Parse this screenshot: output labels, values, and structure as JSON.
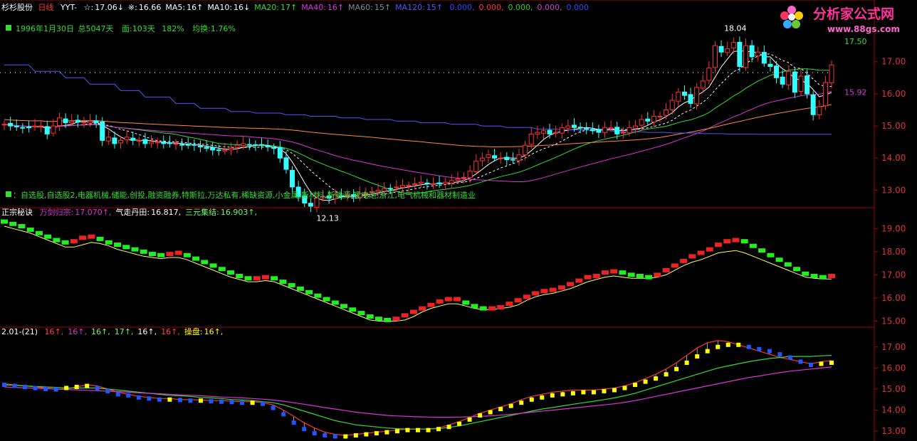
{
  "header": {
    "stock_name": "杉杉股份",
    "period": "日线",
    "indicator": "YYT-",
    "items": [
      {
        "label": "☆:",
        "value": "17.06",
        "arrow": "↓",
        "color": "#ffffff"
      },
      {
        "label": "※:",
        "value": "16.66",
        "arrow": "",
        "color": "#ffffff"
      },
      {
        "label": "MA5:",
        "value": "16",
        "arrow": "↑",
        "color": "#ffffff"
      },
      {
        "label": "MA10:",
        "value": "16",
        "arrow": "↓",
        "color": "#ffffff"
      },
      {
        "label": "MA20:",
        "value": "17",
        "arrow": "↑",
        "color": "#33dd33"
      },
      {
        "label": "MA40:",
        "value": "16",
        "arrow": "↑",
        "color": "#dd33dd"
      },
      {
        "label": "MA60:",
        "value": "15",
        "arrow": "↑",
        "color": "#888888"
      },
      {
        "label": "MA120:",
        "value": "15",
        "arrow": "↑",
        "color": "#5555ff"
      }
    ],
    "tail_values": [
      "0.000",
      "0.000",
      "0.000",
      "0.000",
      "0.000"
    ],
    "tail_colors": [
      "#3344ff",
      "#ff3333",
      "#33cc33",
      "#cc44cc",
      "#3344ff"
    ]
  },
  "info_line": {
    "date": "1996年1月30日",
    "total": "总5047天",
    "area": "面:103天",
    "pct": "182%",
    "avg_turnover": "均换:1.76%"
  },
  "sector_line": "：自选股,自选股2,电器机械,储能,创投,融资融券,特斯拉,万达私有,稀缺资源,小金属,新材料,新能源,锂电池,浙江,电气机械和器材制造业",
  "logo": {
    "title": "分析家公式网",
    "url": "www.88gs.com"
  },
  "panel2_title": {
    "name": "正宗秘诀",
    "items": [
      {
        "label": "万剑归宗:",
        "value": "17.070",
        "arrow": "↑,",
        "color": "#dd33dd"
      },
      {
        "label": "气走丹田:",
        "value": "16.817,",
        "arrow": "",
        "color": "#ffffff"
      },
      {
        "label": "三元集结:",
        "value": "16.903",
        "arrow": "↑,",
        "color": "#66ff66"
      }
    ]
  },
  "panel3_title": {
    "name": "2.01-(21)",
    "items": [
      {
        "value": "16",
        "arrow": "↑,",
        "color": "#ff4444"
      },
      {
        "value": "16",
        "arrow": "↑,",
        "color": "#dd33dd"
      },
      {
        "value": "16",
        "arrow": "↑,",
        "color": "#66ff66"
      },
      {
        "value": "17",
        "arrow": "↑,",
        "color": "#66ff66"
      },
      {
        "value": "16",
        "arrow": "↑,",
        "color": "#ffffff"
      },
      {
        "value": "16",
        "arrow": "↑,",
        "color": "#ff4444"
      },
      {
        "label": "操盘:",
        "value": "16",
        "arrow": "↑,",
        "color": "#ffff00"
      }
    ]
  },
  "chart_data": [
    {
      "type": "candlestick",
      "title": "杉杉股份 日线",
      "ylim": [
        12.5,
        18.3
      ],
      "yticks": [
        13.0,
        14.0,
        15.0,
        16.0,
        17.0
      ],
      "annotations": [
        {
          "text": "18.04",
          "kind": "high"
        },
        {
          "text": "12.13",
          "kind": "low"
        },
        {
          "text": "17.50",
          "kind": "level"
        },
        {
          "text": "15.92",
          "kind": "level"
        }
      ],
      "closes": [
        15.05,
        15.0,
        14.98,
        14.95,
        14.95,
        15.0,
        15.0,
        14.75,
        15.0,
        15.25,
        15.1,
        15.15,
        15.12,
        15.12,
        15.15,
        15.1,
        14.55,
        14.65,
        14.45,
        14.55,
        14.65,
        14.55,
        14.55,
        14.45,
        14.5,
        14.5,
        14.45,
        14.45,
        14.45,
        14.4,
        14.4,
        14.4,
        14.35,
        14.3,
        14.25,
        14.25,
        14.25,
        14.3,
        14.4,
        14.45,
        14.4,
        14.4,
        14.4,
        14.35,
        14.3,
        14.0,
        13.65,
        13.1,
        12.8,
        12.6,
        12.5,
        12.75,
        12.8,
        12.75,
        12.85,
        12.8,
        12.85,
        12.8,
        12.9,
        12.9,
        12.95,
        13.0,
        13.05,
        13.05,
        13.1,
        13.15,
        13.15,
        13.2,
        13.25,
        13.2,
        13.2,
        13.2,
        13.25,
        13.3,
        13.35,
        13.4,
        13.6,
        13.9,
        14.0,
        14.1,
        14.0,
        14.0,
        13.95,
        13.95,
        14.1,
        14.4,
        14.75,
        14.8,
        14.85,
        14.75,
        14.8,
        14.95,
        15.0,
        14.95,
        14.95,
        14.9,
        14.85,
        14.8,
        14.95,
        14.95,
        14.75,
        14.8,
        14.95,
        15.0,
        15.2,
        15.15,
        15.3,
        15.3,
        15.5,
        15.8,
        16.05,
        15.95,
        15.7,
        16.2,
        16.4,
        16.8,
        17.5,
        17.3,
        17.4,
        17.6,
        16.85,
        17.5,
        17.15,
        17.3,
        16.95,
        16.85,
        16.5,
        16.3,
        16.7,
        16.05,
        16.55,
        16.0,
        15.35,
        15.6,
        16.35,
        16.9
      ]
    },
    {
      "type": "line",
      "title": "正宗秘诀",
      "ylim": [
        14.8,
        19.5
      ],
      "yticks": [
        15.0,
        16.0,
        17.0,
        18.0,
        19.0
      ],
      "series": [
        {
          "name": "万剑归宗",
          "values": [
            19.3,
            19.2,
            19.1,
            18.95,
            18.8,
            18.65,
            18.5,
            18.4,
            18.45,
            18.6,
            18.65,
            18.55,
            18.4,
            18.3,
            18.2,
            18.1,
            18.0,
            17.9,
            17.85,
            17.9,
            17.95,
            17.85,
            17.7,
            17.55,
            17.4,
            17.25,
            17.1,
            16.95,
            16.85,
            16.85,
            16.9,
            16.85,
            16.7,
            16.55,
            16.4,
            16.25,
            16.1,
            15.95,
            15.8,
            15.65,
            15.5,
            15.35,
            15.2,
            15.1,
            15.05,
            15.1,
            15.25,
            15.4,
            15.55,
            15.7,
            15.85,
            15.95,
            15.95,
            15.8,
            15.65,
            15.55,
            15.55,
            15.6,
            15.75,
            15.9,
            16.05,
            16.2,
            16.3,
            16.35,
            16.45,
            16.6,
            16.75,
            16.9,
            16.95,
            17.1,
            17.15,
            17.1,
            17.0,
            16.95,
            16.9,
            17.0,
            17.2,
            17.4,
            17.6,
            17.8,
            17.95,
            18.1,
            18.3,
            18.45,
            18.5,
            18.45,
            18.25,
            18.05,
            17.85,
            17.65,
            17.45,
            17.25,
            17.05,
            16.95,
            16.9,
            16.95
          ]
        },
        {
          "name": "气走丹田",
          "values": [
            19.1,
            19.0,
            18.9,
            18.8,
            18.65,
            18.5,
            18.35,
            18.2,
            18.2,
            18.3,
            18.4,
            18.35,
            18.25,
            18.1,
            18.0,
            17.9,
            17.8,
            17.75,
            17.7,
            17.75,
            17.75,
            17.65,
            17.5,
            17.35,
            17.2,
            17.05,
            16.9,
            16.8,
            16.7,
            16.7,
            16.75,
            16.7,
            16.55,
            16.4,
            16.25,
            16.1,
            15.95,
            15.8,
            15.65,
            15.5,
            15.35,
            15.2,
            15.05,
            15.0,
            15.0,
            15.0,
            15.05,
            15.2,
            15.4,
            15.55,
            15.65,
            15.75,
            15.75,
            15.65,
            15.55,
            15.5,
            15.5,
            15.55,
            15.6,
            15.7,
            15.9,
            16.05,
            16.15,
            16.2,
            16.3,
            16.4,
            16.55,
            16.7,
            16.8,
            16.9,
            16.95,
            16.9,
            16.85,
            16.85,
            16.85,
            16.9,
            17.0,
            17.2,
            17.4,
            17.55,
            17.65,
            17.8,
            17.95,
            18.0,
            18.05,
            17.95,
            17.8,
            17.65,
            17.5,
            17.35,
            17.2,
            17.05,
            16.9,
            16.85,
            16.82,
            16.82
          ]
        }
      ]
    },
    {
      "type": "line",
      "title": "2.01-(21)",
      "ylim": [
        12.6,
        17.6
      ],
      "yticks": [
        13.0,
        14.0,
        15.0,
        16.0,
        17.0
      ],
      "series": [
        {
          "name": "操盘",
          "values": [
            15.2,
            15.15,
            15.1,
            15.05,
            15.0,
            14.98,
            15.05,
            15.1,
            15.15,
            15.05,
            14.9,
            14.75,
            14.7,
            14.6,
            14.55,
            14.5,
            14.5,
            14.48,
            14.45,
            14.45,
            14.42,
            14.4,
            14.38,
            14.35,
            14.35,
            14.3,
            14.1,
            13.8,
            13.4,
            13.1,
            12.9,
            12.8,
            12.75,
            12.75,
            12.8,
            12.85,
            12.9,
            12.95,
            13.0,
            13.05,
            13.05,
            13.05,
            13.1,
            13.2,
            13.35,
            13.55,
            13.75,
            13.9,
            14.05,
            14.2,
            14.35,
            14.5,
            14.6,
            14.7,
            14.75,
            14.8,
            14.85,
            14.85,
            14.9,
            14.95,
            15.05,
            15.2,
            15.35,
            15.5,
            15.7,
            15.95,
            16.25,
            16.55,
            16.8,
            17.0,
            17.1,
            17.1,
            17.0,
            16.9,
            16.8,
            16.65,
            16.5,
            16.3,
            16.15,
            16.2,
            16.25
          ]
        },
        {
          "name": "线2",
          "values": [
            15.25,
            15.2,
            15.15,
            15.1,
            15.05,
            15.0,
            15.0,
            15.1,
            15.2,
            15.15,
            15.0,
            14.85,
            14.75,
            14.65,
            14.6,
            14.55,
            14.55,
            14.5,
            14.5,
            14.48,
            14.45,
            14.45,
            14.42,
            14.4,
            14.4,
            14.35,
            14.25,
            14.0,
            13.7,
            13.4,
            13.15,
            12.95,
            12.85,
            12.8,
            12.85,
            12.9,
            12.95,
            13.0,
            13.05,
            13.1,
            13.1,
            13.1,
            13.15,
            13.3,
            13.45,
            13.65,
            13.85,
            14.0,
            14.15,
            14.3,
            14.5,
            14.65,
            14.75,
            14.85,
            14.9,
            14.95,
            14.95,
            14.95,
            15.0,
            15.05,
            15.15,
            15.3,
            15.5,
            15.7,
            15.95,
            16.25,
            16.6,
            16.95,
            17.2,
            17.3,
            17.25,
            17.1,
            16.95,
            16.8,
            16.65,
            16.5,
            16.4,
            16.3,
            16.2,
            16.3,
            16.35
          ]
        },
        {
          "name": "线3",
          "values": [
            15.2,
            15.18,
            15.15,
            15.12,
            15.1,
            15.08,
            15.05,
            15.05,
            15.05,
            15.05,
            15.0,
            14.95,
            14.9,
            14.85,
            14.8,
            14.75,
            14.7,
            14.68,
            14.65,
            14.6,
            14.58,
            14.55,
            14.5,
            14.48,
            14.45,
            14.4,
            14.35,
            14.25,
            14.1,
            13.95,
            13.8,
            13.65,
            13.5,
            13.4,
            13.3,
            13.25,
            13.2,
            13.15,
            13.12,
            13.1,
            13.1,
            13.1,
            13.12,
            13.18,
            13.25,
            13.35,
            13.45,
            13.55,
            13.65,
            13.75,
            13.85,
            13.95,
            14.05,
            14.12,
            14.2,
            14.28,
            14.35,
            14.42,
            14.5,
            14.58,
            14.68,
            14.8,
            14.95,
            15.1,
            15.25,
            15.4,
            15.55,
            15.7,
            15.85,
            16.0,
            16.1,
            16.2,
            16.3,
            16.38,
            16.45,
            16.5,
            16.55,
            16.55,
            16.55,
            16.58,
            16.6
          ]
        },
        {
          "name": "线4",
          "values": [
            15.1,
            15.08,
            15.06,
            15.04,
            15.02,
            15.0,
            14.98,
            14.96,
            14.94,
            14.92,
            14.9,
            14.88,
            14.85,
            14.82,
            14.8,
            14.78,
            14.75,
            14.72,
            14.7,
            14.68,
            14.65,
            14.62,
            14.6,
            14.58,
            14.55,
            14.52,
            14.48,
            14.42,
            14.35,
            14.28,
            14.2,
            14.12,
            14.05,
            13.98,
            13.9,
            13.85,
            13.8,
            13.75,
            13.72,
            13.7,
            13.68,
            13.67,
            13.66,
            13.66,
            13.67,
            13.68,
            13.7,
            13.73,
            13.76,
            13.8,
            13.85,
            13.9,
            13.95,
            14.0,
            14.05,
            14.1,
            14.15,
            14.2,
            14.25,
            14.3,
            14.37,
            14.45,
            14.55,
            14.65,
            14.75,
            14.85,
            14.95,
            15.05,
            15.15,
            15.25,
            15.35,
            15.45,
            15.55,
            15.62,
            15.7,
            15.78,
            15.85,
            15.9,
            15.95,
            16.0,
            16.05
          ]
        }
      ]
    }
  ]
}
